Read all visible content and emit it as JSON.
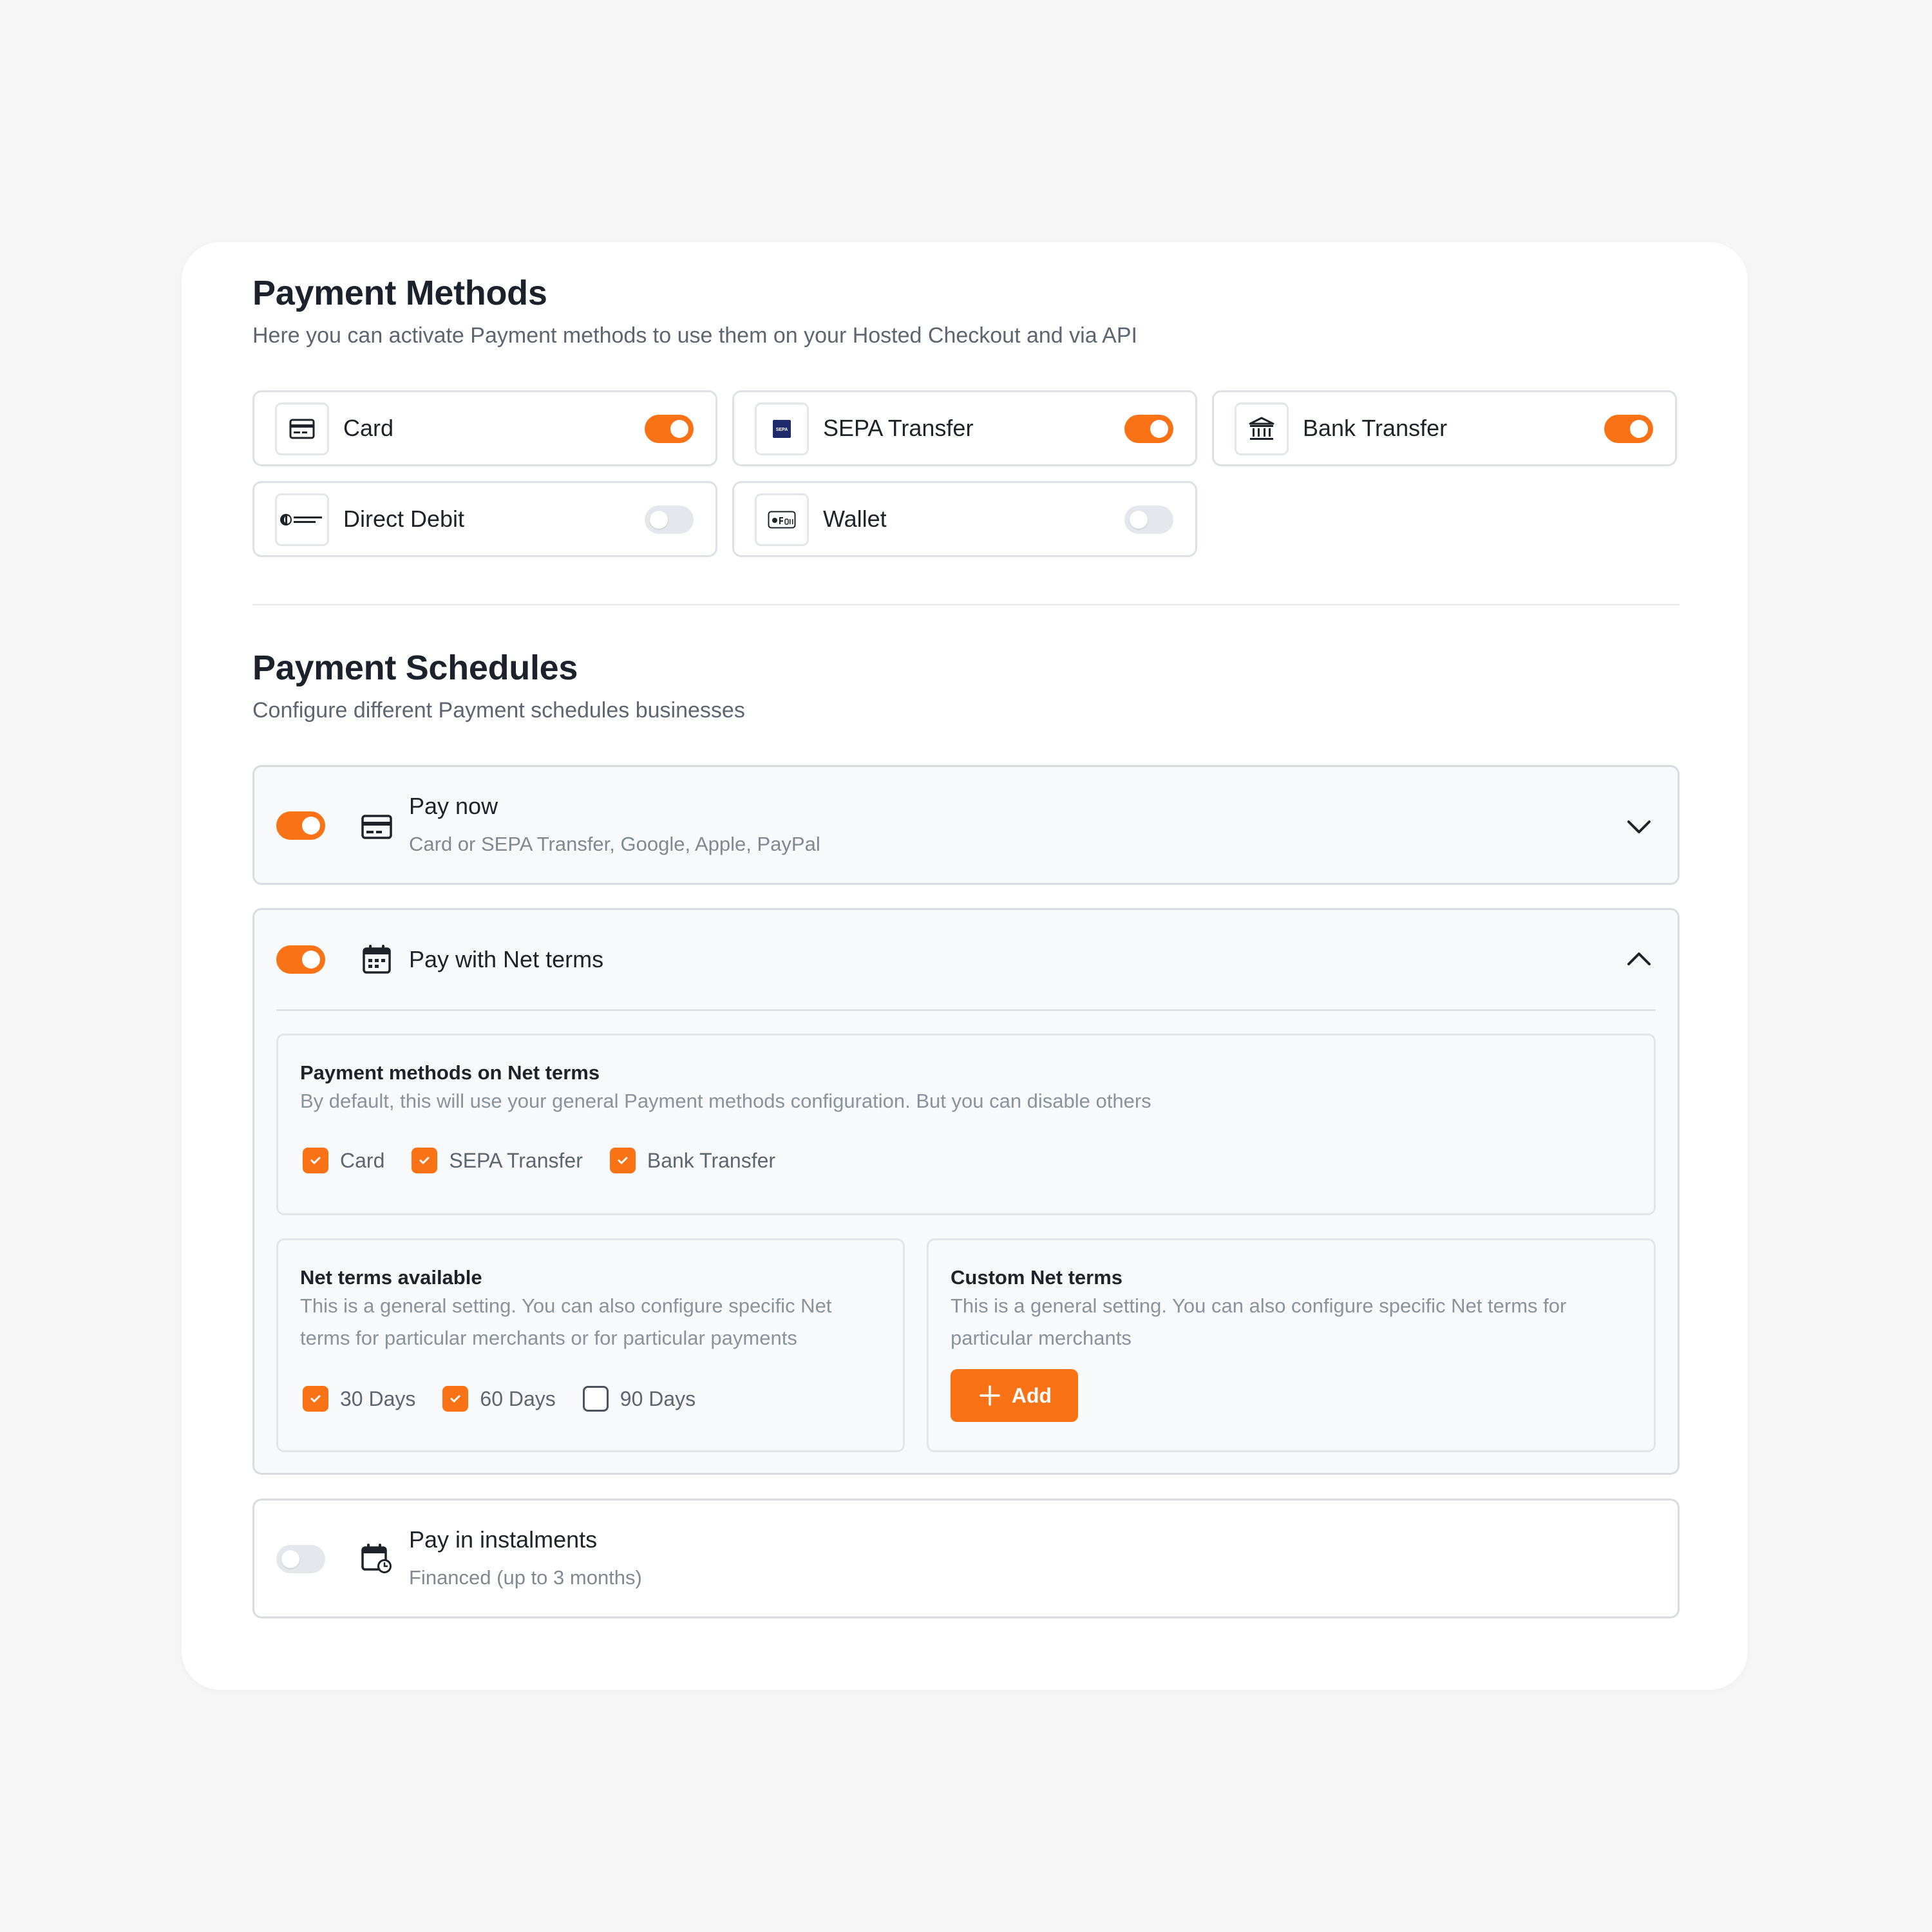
{
  "payment_methods": {
    "title": "Payment Methods",
    "subtitle": "Here you can activate Payment methods to use them on your Hosted Checkout and via API",
    "items": [
      {
        "label": "Card",
        "icon": "credit-card-icon",
        "enabled": true
      },
      {
        "label": "SEPA Transfer",
        "icon": "sepa-logo-icon",
        "enabled": true
      },
      {
        "label": "Bank Transfer",
        "icon": "bank-icon",
        "enabled": true
      },
      {
        "label": "Direct Debit",
        "icon": "direct-debit-logo-icon",
        "enabled": false
      },
      {
        "label": "Wallet",
        "icon": "apple-pay-logo-icon",
        "enabled": false
      }
    ]
  },
  "payment_schedules": {
    "title": "Payment Schedules",
    "subtitle": "Configure different Payment schedules businesses",
    "pay_now": {
      "title": "Pay now",
      "subtitle": "Card or SEPA Transfer, Google, Apple, PayPal",
      "enabled": true,
      "expanded": false
    },
    "net_terms": {
      "title": "Pay with Net terms",
      "enabled": true,
      "expanded": true,
      "methods_box": {
        "title": "Payment methods on Net terms",
        "description": "By default, this will use your general Payment methods configuration. But you can disable others",
        "options": [
          {
            "label": "Card",
            "checked": true
          },
          {
            "label": "SEPA Transfer",
            "checked": true
          },
          {
            "label": "Bank Transfer",
            "checked": true
          }
        ]
      },
      "available_box": {
        "title": "Net terms available",
        "description_line1": "This is a general setting. You can also configure specific Net",
        "description_line2": "terms for particular merchants or for particular payments",
        "options": [
          {
            "label": "30 Days",
            "checked": true
          },
          {
            "label": "60 Days",
            "checked": true
          },
          {
            "label": "90 Days",
            "checked": false
          }
        ]
      },
      "custom_box": {
        "title": "Custom Net terms",
        "description_line1": "This is a general setting. You can also configure specific Net terms for",
        "description_line2": "particular merchants",
        "add_label": "Add"
      }
    },
    "instalments": {
      "title": "Pay in instalments",
      "subtitle": "Financed (up to 3 months)",
      "enabled": false
    }
  },
  "colors": {
    "accent": "#f97316",
    "toggle_off": "#e4e7eb",
    "border": "#dde1e6"
  }
}
